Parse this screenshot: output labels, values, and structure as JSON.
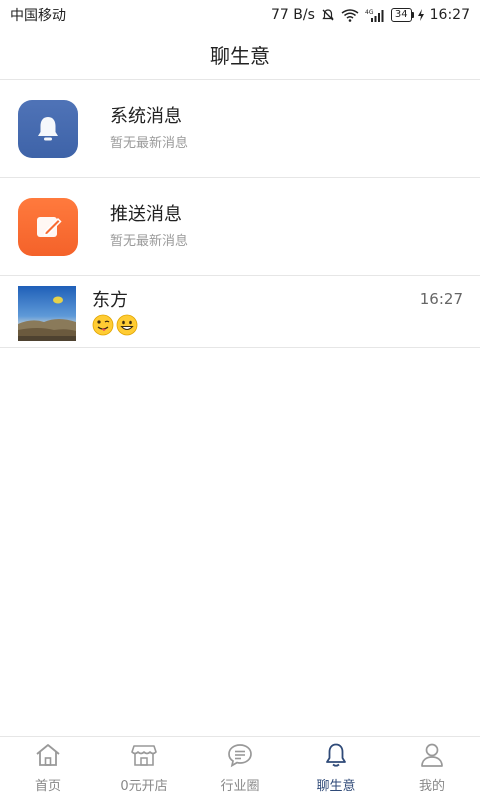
{
  "status_bar": {
    "carrier": "中国移动",
    "net_speed": "77 B/s",
    "network_badge": "4G",
    "battery": "34",
    "time": "16:27"
  },
  "header": {
    "title": "聊生意"
  },
  "messages": {
    "system": {
      "title": "系统消息",
      "subtitle": "暂无最新消息",
      "icon": "bell-icon",
      "color": "#4a6db3"
    },
    "push": {
      "title": "推送消息",
      "subtitle": "暂无最新消息",
      "icon": "edit-icon",
      "color": "#f86d33"
    },
    "chats": [
      {
        "name": "东方",
        "time": "16:27",
        "emojis": [
          "winking-tongue-emoji",
          "grinning-emoji"
        ]
      }
    ]
  },
  "bottom_nav": {
    "items": [
      {
        "label": "首页",
        "icon": "home-icon"
      },
      {
        "label": "0元开店",
        "icon": "store-icon"
      },
      {
        "label": "行业圈",
        "icon": "chat-bubble-icon"
      },
      {
        "label": "聊生意",
        "icon": "bell-icon"
      },
      {
        "label": "我的",
        "icon": "user-icon"
      }
    ],
    "active_index": 3,
    "active_color": "#2f4a78"
  }
}
